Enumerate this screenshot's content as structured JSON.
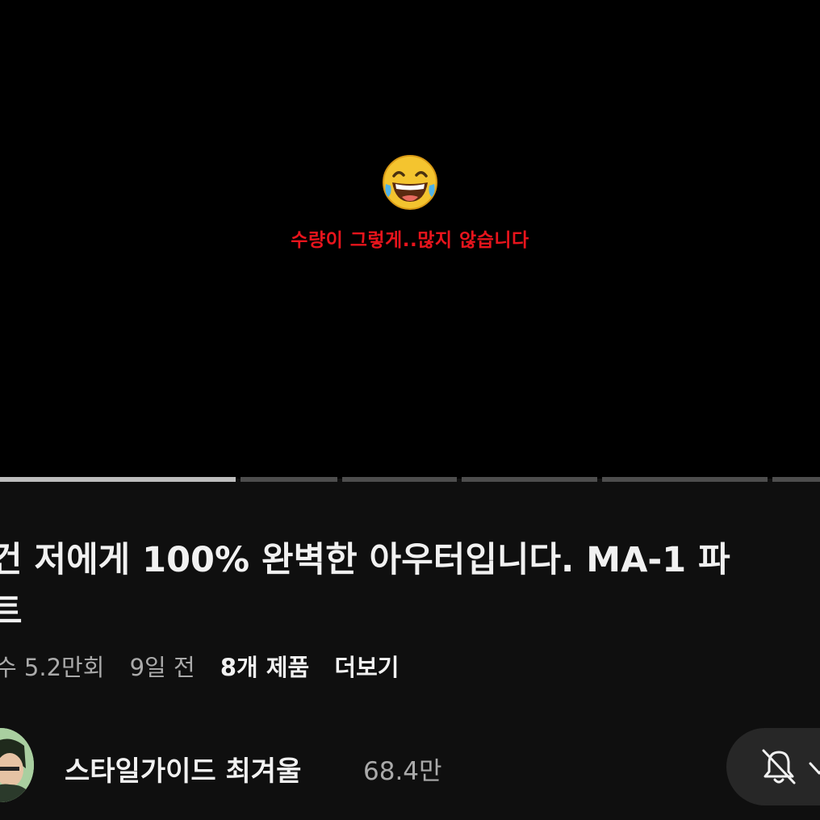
{
  "video": {
    "emoji": "face-with-tears-of-joy",
    "caption": "수량이 그렇게..많지 않습니다",
    "caption_color": "#e8141c",
    "chapter_progress": [
      1.0,
      0.0,
      0.0,
      0.0,
      0.0,
      0.0
    ]
  },
  "title": {
    "line1": "건 저에게 100% 완벽한 아우터입니다. MA-1 파",
    "line2": "트"
  },
  "meta": {
    "views": "수 5.2만회",
    "age": "9일 전",
    "products": "8개 제품",
    "more": "더보기"
  },
  "channel": {
    "name": "스타일가이드 최겨울",
    "subscribers": "68.4만",
    "subscribe_state_icon": "bell-off-icon"
  }
}
